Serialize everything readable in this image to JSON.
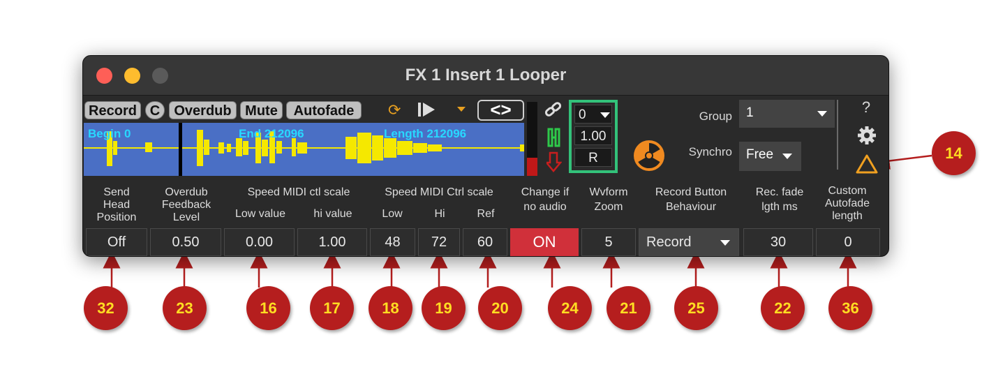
{
  "window": {
    "title": "FX 1 Insert 1 Looper"
  },
  "toolbar": {
    "record": "Record",
    "clear": "C",
    "overdub": "Overdub",
    "mute": "Mute",
    "autofade": "Autofade",
    "loop_icon": "loop-icon",
    "play_icon": "play-from-start-icon",
    "menu_caret": "dropdown-caret-icon",
    "nudge": "<>"
  },
  "waveform": {
    "begin": "Begin 0",
    "end": "End 212096",
    "length": "Length 212096"
  },
  "sync_panel": {
    "top_value": "0",
    "speed": "1.00",
    "reset": "R"
  },
  "group": {
    "label": "Group",
    "value": "1"
  },
  "synchro": {
    "label": "Synchro",
    "value": "Free"
  },
  "side": {
    "help": "?",
    "settings_icon": "gear-icon",
    "warning_icon": "warning-triangle-icon"
  },
  "params": {
    "send_head": {
      "label1": "Send",
      "label2": "Head",
      "label3": "Position",
      "value": "Off"
    },
    "overdub_fb": {
      "label1": "Overdub",
      "label2": "Feedback",
      "label3": "Level",
      "value": "0.50"
    },
    "speed_midi_ctl_scale": "Speed MIDI ctl scale",
    "low_value": {
      "label": "Low value",
      "value": "0.00"
    },
    "hi_value": {
      "label": "hi value",
      "value": "1.00"
    },
    "speed_midi_ctrl_scale": "Speed MIDI Ctrl scale",
    "low": {
      "label": "Low",
      "value": "48"
    },
    "hi": {
      "label": "Hi",
      "value": "72"
    },
    "ref": {
      "label": "Ref",
      "value": "60"
    },
    "change_if": {
      "label1": "Change if",
      "label2": "no audio",
      "value": "ON"
    },
    "wvform_zoom": {
      "label1": "Wvform",
      "label2": "Zoom",
      "value": "5"
    },
    "record_behaviour": {
      "label1": "Record Button",
      "label2": "Behaviour",
      "value": "Record"
    },
    "rec_fade": {
      "label1": "Rec. fade",
      "label2": "lgth ms",
      "value": "30"
    },
    "custom_autofade": {
      "label1": "Custom",
      "label2": "Autofade",
      "label3": "length",
      "value": "0"
    }
  },
  "callouts": [
    "32",
    "23",
    "16",
    "17",
    "18",
    "19",
    "20",
    "24",
    "21",
    "25",
    "22",
    "36",
    "14"
  ],
  "colors": {
    "accent_orange": "#e8a020",
    "waveform_bg": "#4a6fc5",
    "waveform_fg": "#f5e800",
    "on_red": "#d0303a",
    "green_border": "#33c27a",
    "callout": "#b51e1e"
  }
}
